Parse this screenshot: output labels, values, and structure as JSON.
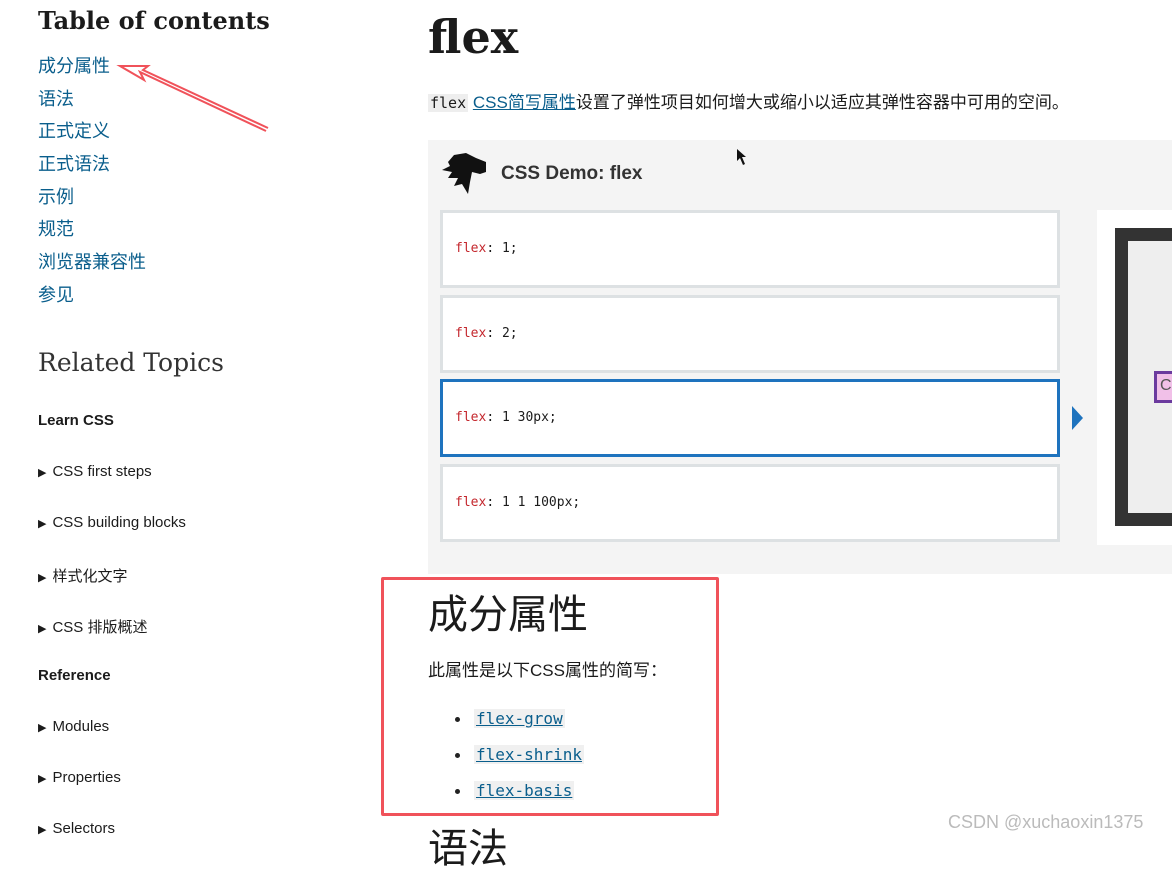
{
  "toc": {
    "title": "Table of contents",
    "items": [
      "成分属性",
      "语法",
      "正式定义",
      "正式语法",
      "示例",
      "规范",
      "浏览器兼容性",
      "参见"
    ]
  },
  "related": {
    "title": "Related Topics",
    "learn_heading": "Learn CSS",
    "learn_items": [
      "CSS first steps",
      "CSS building blocks",
      "样式化文字",
      "CSS 排版概述"
    ],
    "reference_heading": "Reference",
    "reference_items": [
      "Modules",
      "Properties",
      "Selectors"
    ]
  },
  "main": {
    "title": "flex",
    "intro": {
      "code": "flex",
      "link": "CSS简写属性",
      "text": "设置了弹性项目如何增大或缩小以适应其弹性容器中可用的空间。"
    },
    "demo": {
      "title": "CSS Demo: flex",
      "options": [
        {
          "prop": "flex",
          "value": " 1;"
        },
        {
          "prop": "flex",
          "value": " 2;"
        },
        {
          "prop": "flex",
          "value": " 1 30px;"
        },
        {
          "prop": "flex",
          "value": " 1 1 100px;"
        }
      ],
      "selected_index": 2,
      "output_letter": "C"
    },
    "section": {
      "title": "成分属性",
      "text": "此属性是以下CSS属性的简写：",
      "links": [
        "flex-grow",
        "flex-shrink",
        "flex-basis"
      ]
    },
    "next_heading": "语法"
  },
  "watermark": "CSDN @xuchaoxin1375",
  "colors": {
    "link": "#0a5e8c",
    "highlight": "#f0525a",
    "selected": "#1e73be",
    "keyword": "#c4272d"
  }
}
